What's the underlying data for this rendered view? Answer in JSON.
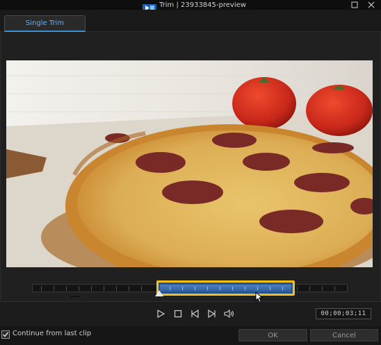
{
  "window": {
    "title": "Trim | 23933845-preview",
    "app_icon": "powerdirector-logo",
    "buttons": [
      "restore-icon",
      "close-icon"
    ]
  },
  "tabs": [
    {
      "label": "Single Trim",
      "active": true
    }
  ],
  "preview": {
    "content": "video-frame",
    "colors": {
      "tomato": "#c8281a",
      "pizza_crust": "#d4953c",
      "salami": "#7a2a26",
      "board": "#b98c5c"
    }
  },
  "timeline": {
    "selection_start": 0.396,
    "selection_end": 0.835,
    "playhead": 0.696,
    "selection_color": "#f2c21b",
    "selection_fill": "#3a6cb0"
  },
  "controls": {
    "icons": [
      "play-icon",
      "stop-icon",
      "previous-frame-icon",
      "next-frame-icon",
      "volume-icon"
    ],
    "timecode": "00;00;03;11"
  },
  "footer": {
    "checkbox_label": "Continue from last clip",
    "checkbox_checked": true,
    "ok_label": "OK",
    "cancel_label": "Cancel"
  }
}
